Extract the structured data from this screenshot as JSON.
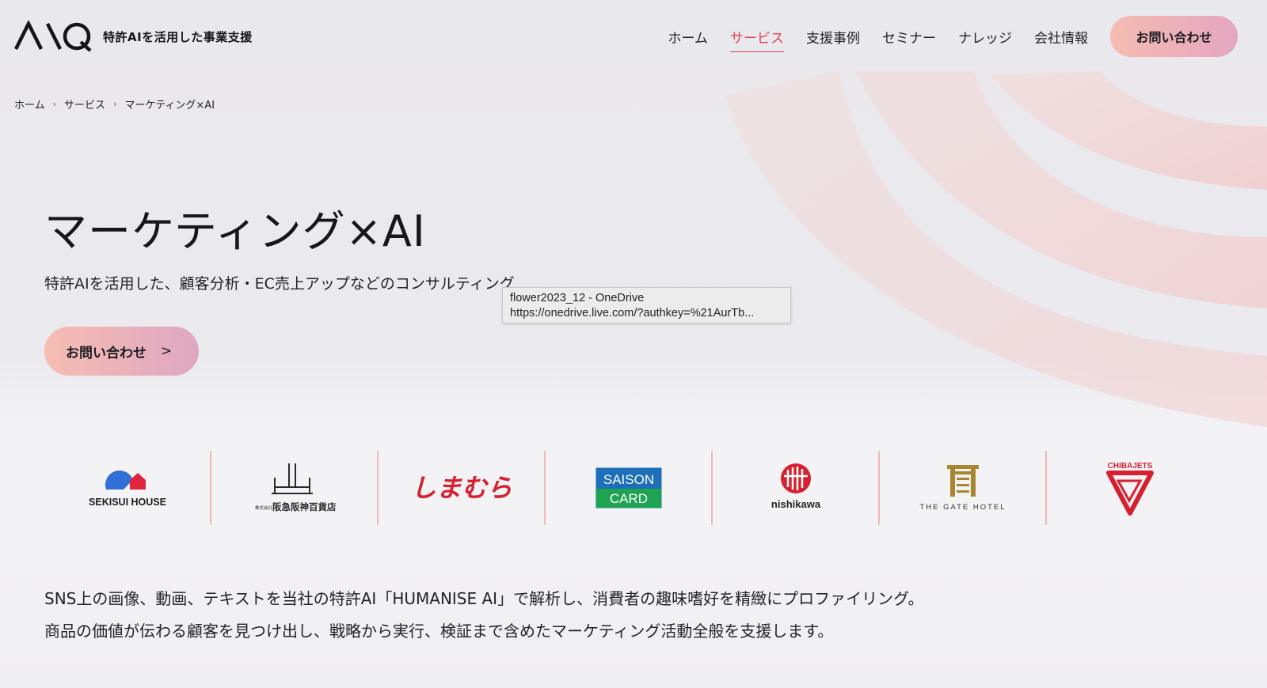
{
  "header": {
    "logo_text": "特許AIを活用した事業支援",
    "nav": [
      {
        "label": "ホーム",
        "active": false
      },
      {
        "label": "サービス",
        "active": true
      },
      {
        "label": "支援事例",
        "active": false
      },
      {
        "label": "セミナー",
        "active": false
      },
      {
        "label": "ナレッジ",
        "active": false
      },
      {
        "label": "会社情報",
        "active": false
      }
    ],
    "cta_label": "お問い合わせ"
  },
  "breadcrumb": [
    "ホーム",
    "サービス",
    "マーケティング×AI"
  ],
  "hero": {
    "title": "マーケティング×AI",
    "subtitle": "特許AIを活用した、顧客分析・EC売上アップなどのコンサルティング",
    "cta_label": "お問い合わせ",
    "cta_arrow": ">"
  },
  "tooltip": {
    "title": "flower2023_12 - OneDrive",
    "url": "https://onedrive.live.com/?authkey=%21AurTb..."
  },
  "client_logos": {
    "sekisui": "SEKISUI HOUSE",
    "hankyu": "阪急阪神百貨店",
    "hankyu_prefix": "株式会社",
    "shimamura": "しまむら",
    "saison_top": "SAISON",
    "saison_bottom": "CARD",
    "nishikawa": "nishikawa",
    "gate": "THE GATE HOTEL",
    "chiba": "CHIBAJETS"
  },
  "description": [
    "SNS上の画像、動画、テキストを当社の特許AI「HUMANISE AI」で解析し、消費者の趣味嗜好を精緻にプロファイリング。",
    "商品の価値が伝わる顧客を見つけ出し、戦略から実行、検証まで含めたマーケティング活動全般を支援します。"
  ],
  "colors": {
    "accent": "#e0435a",
    "cta_gradient_start": "#f6bcb2",
    "cta_gradient_end": "#e3a6c0",
    "divider": "#f0b8b8"
  }
}
